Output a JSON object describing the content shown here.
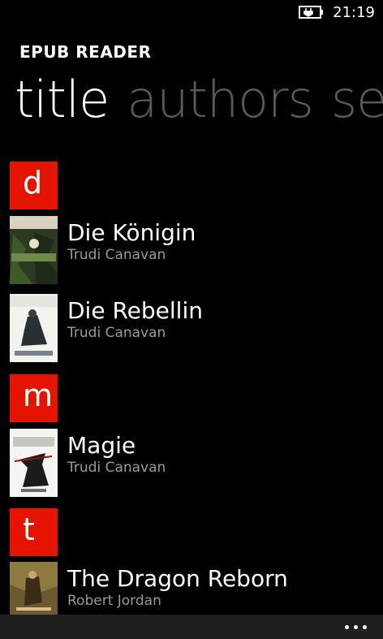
{
  "status": {
    "time": "21:19",
    "battery_icon": "battery-charging-icon"
  },
  "app": {
    "title": "EPUB READER"
  },
  "pivot": [
    {
      "label": "title",
      "active": true
    },
    {
      "label": "authors",
      "active": false
    },
    {
      "label": "se",
      "active": false
    }
  ],
  "groups": [
    {
      "letter": "d"
    },
    {
      "letter": "m"
    },
    {
      "letter": "t"
    }
  ],
  "books": [
    {
      "title": "Die Königin",
      "author": "Trudi Canavan"
    },
    {
      "title": "Die Rebellin",
      "author": "Trudi Canavan"
    },
    {
      "title": "Magie",
      "author": "Trudi Canavan"
    },
    {
      "title": "The Dragon Reborn",
      "author": "Robert Jordan"
    }
  ],
  "colors": {
    "accent": "#e51400",
    "inactive_pivot": "#5a5a5a",
    "subtext": "#9a9a9a",
    "app_bar": "#1f1f1f"
  }
}
